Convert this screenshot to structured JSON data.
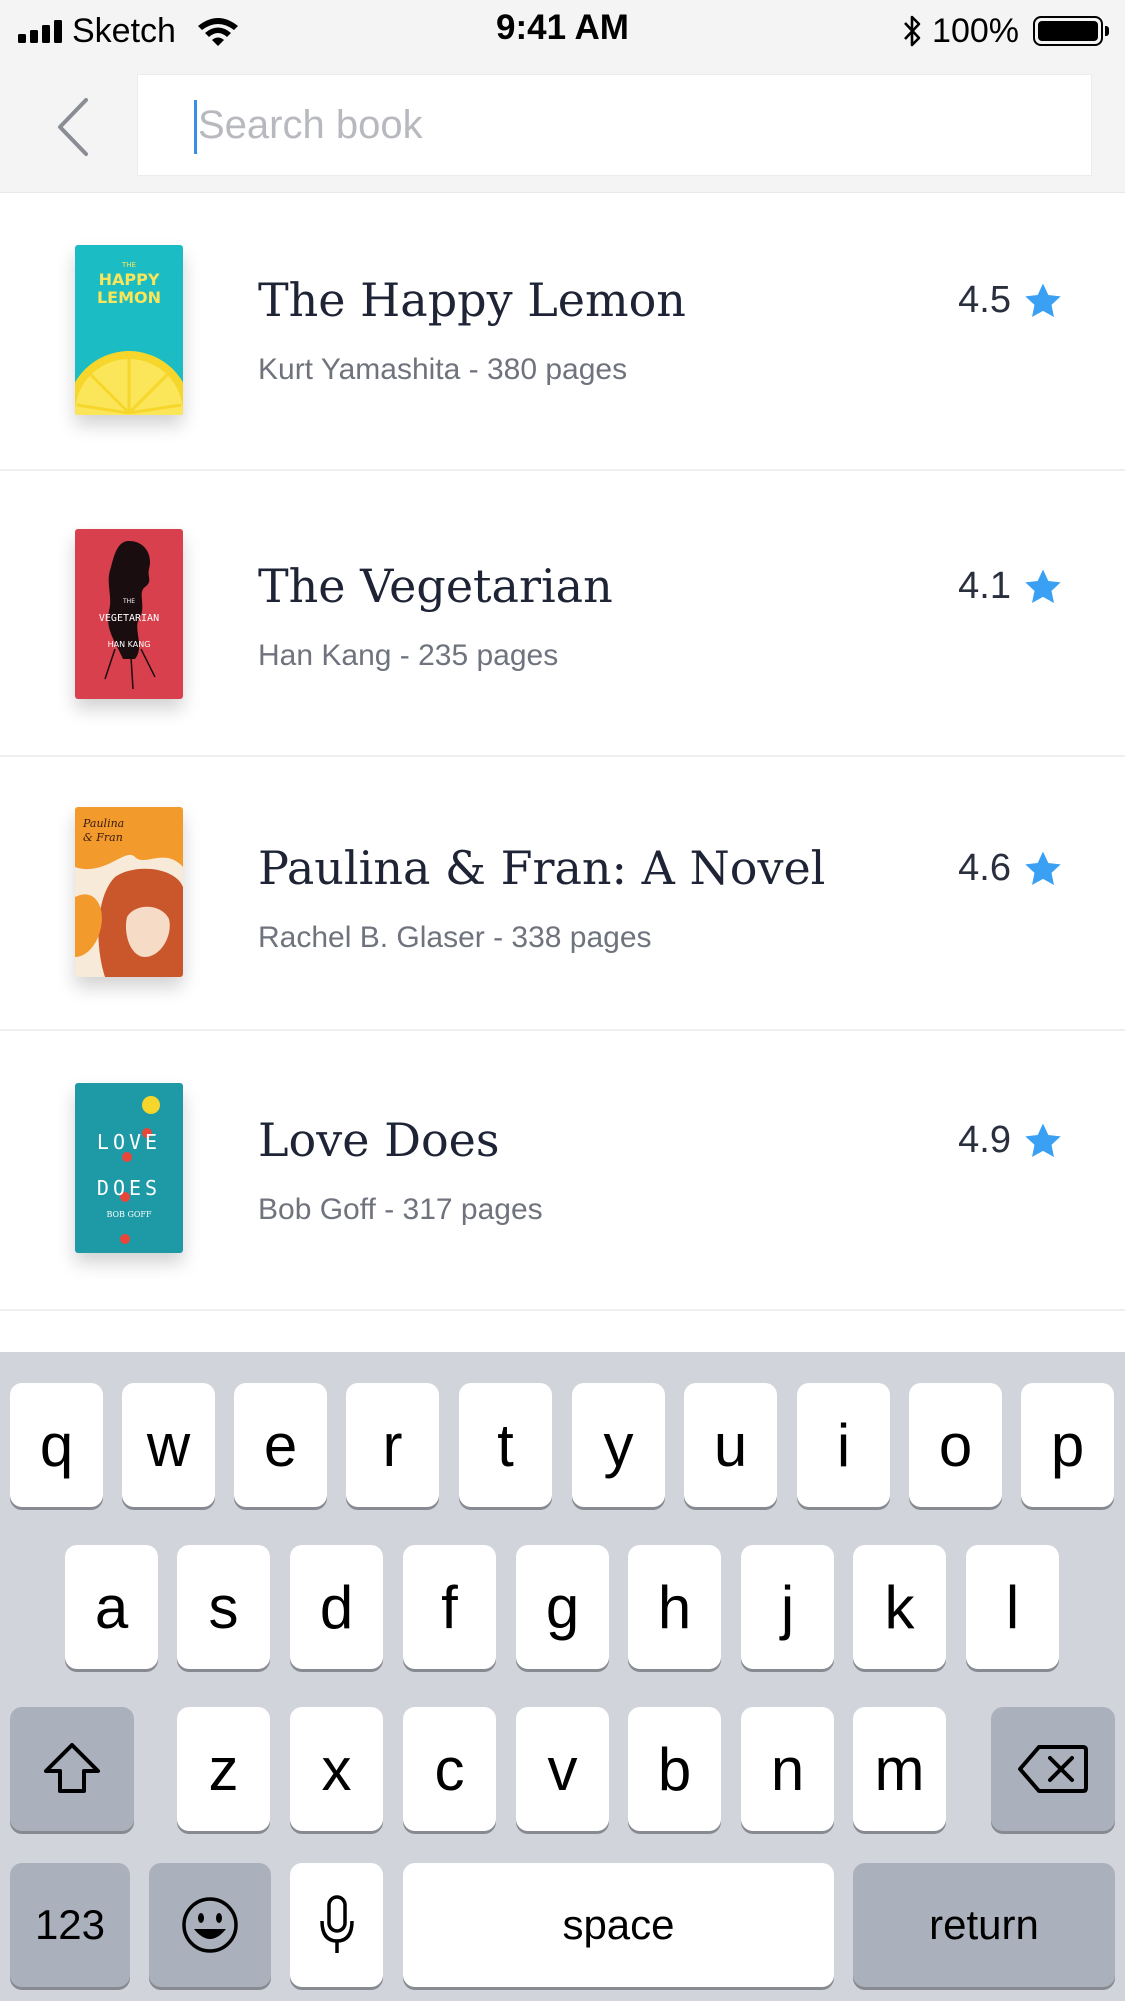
{
  "status_bar": {
    "carrier": "Sketch",
    "time": "9:41 AM",
    "battery": "100%",
    "icons": [
      "signal-icon",
      "wifi-icon",
      "bluetooth-icon",
      "battery-icon"
    ]
  },
  "search": {
    "placeholder": "Search book",
    "value": "",
    "back_icon": "chevron-left-icon",
    "caret_color": "#3a8ee6"
  },
  "books": [
    {
      "title": "The Happy Lemon",
      "author": "Kurt Yamashita",
      "pages": "380 pages",
      "meta": "Kurt Yamashita - 380 pages",
      "rating": "4.5",
      "cover_text": [
        "THE",
        "HAPPY",
        "LEMON"
      ]
    },
    {
      "title": "The Vegetarian",
      "author": "Han Kang",
      "pages": "235 pages",
      "meta": "Han Kang - 235 pages",
      "rating": "4.1",
      "cover_text": [
        "THE",
        "VEGETARIAN",
        "HAN KANG"
      ]
    },
    {
      "title": "Paulina & Fran: A Novel",
      "author": "Rachel B. Glaser",
      "pages": "338 pages",
      "meta": "Rachel B. Glaser - 338 pages",
      "rating": "4.6",
      "cover_text": [
        "Paulina",
        "& Fran"
      ]
    },
    {
      "title": "Love Does",
      "author": "Bob Goff",
      "pages": "317 pages",
      "meta": "Bob Goff - 317 pages",
      "rating": "4.9",
      "cover_text": [
        "LOVE",
        "DOES",
        "BOB GOFF"
      ]
    }
  ],
  "rating_star_color": "#3aa0f3",
  "keyboard": {
    "row1": [
      "q",
      "w",
      "e",
      "r",
      "t",
      "y",
      "u",
      "i",
      "o",
      "p"
    ],
    "row2": [
      "a",
      "s",
      "d",
      "f",
      "g",
      "h",
      "j",
      "k",
      "l"
    ],
    "row3": [
      "z",
      "x",
      "c",
      "v",
      "b",
      "n",
      "m"
    ],
    "numbers": "123",
    "space": "space",
    "return": "return",
    "icons": [
      "shift-icon",
      "backspace-icon",
      "emoji-icon",
      "microphone-icon"
    ]
  }
}
